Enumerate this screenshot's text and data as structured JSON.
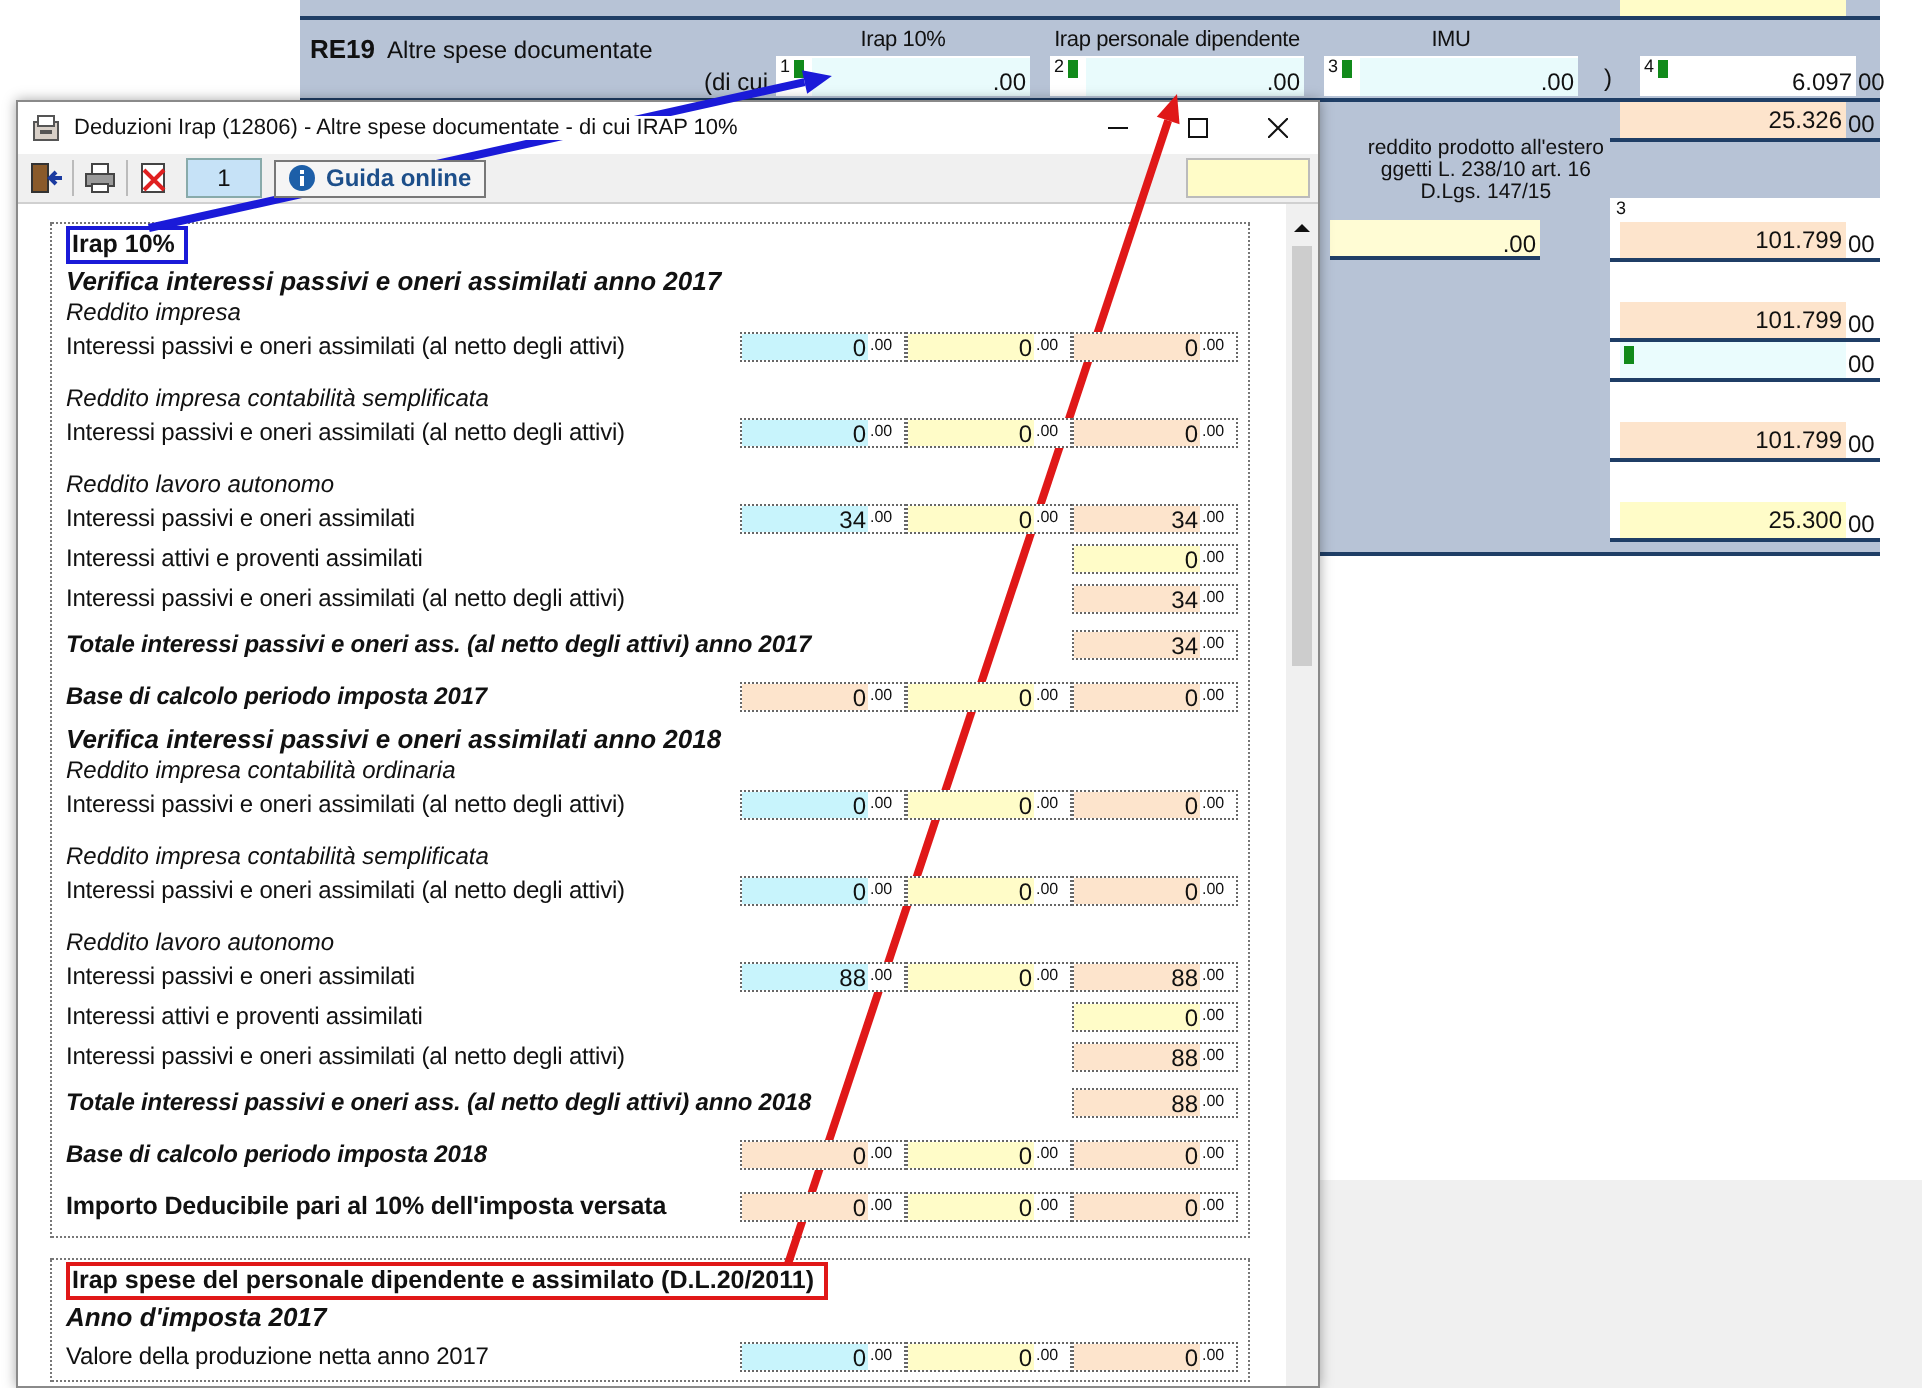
{
  "background_form": {
    "line_code": "RE19",
    "line_label": "Altre spese documentate",
    "of_which": "(di cui",
    "closing": ")",
    "fields": [
      {
        "header": "Irap 10%",
        "index": "1",
        "decimals": ".00",
        "marked": true
      },
      {
        "header": "Irap personale dipendente",
        "index": "2",
        "decimals": ".00",
        "marked": true
      },
      {
        "header": "IMU",
        "index": "3",
        "decimals": ".00",
        "marked": true
      },
      {
        "index": "4",
        "value": "6.097",
        "decimals": "00",
        "marked": true
      }
    ],
    "note": [
      "reddito prodotto all'estero",
      "ggetti L. 238/10 art. 16",
      "D.Lgs. 147/15"
    ],
    "note_field": {
      "decimals": ".00",
      "color": "#fffcd4"
    },
    "column_fields": [
      {
        "value": "25.326",
        "decimals": "00",
        "color": "#fde4cc",
        "marked": false
      },
      {
        "index": "3",
        "value": "101.799",
        "decimals": "00",
        "color": "#fde4cc",
        "marked": false
      },
      {
        "value": "101.799",
        "decimals": "00",
        "color": "#fde4cc",
        "marked": false
      },
      {
        "decimals": "00",
        "color": "#eafcfd",
        "marked": true
      },
      {
        "value": "101.799",
        "decimals": "00",
        "color": "#fde4cc",
        "marked": false
      },
      {
        "value": "25.300",
        "decimals": "00",
        "color": "#fffcc8",
        "marked": false
      }
    ]
  },
  "dialog": {
    "title": "Deduzioni Irap (12806) - Altre spese documentate - di cui IRAP 10%",
    "toolbar": {
      "counter": "1",
      "help_button": "Guida online"
    },
    "sections": [
      {
        "title": "Irap 10%",
        "color": "#1a1ad8",
        "rows": [
          {
            "kind": "heading",
            "text": "Verifica interessi passivi e oneri assimilati anno 2017"
          },
          {
            "kind": "subheading",
            "text": "Reddito impresa"
          },
          {
            "kind": "row",
            "label": "Interessi passivi e oneri assimilati (al netto degli attivi)",
            "fields": [
              {
                "value": "0",
                "decimals": ".00",
                "color": "#c8f4fc"
              },
              {
                "value": "0",
                "decimals": ".00",
                "color": "#fffcc8"
              },
              {
                "value": "0",
                "decimals": ".00",
                "color": "#fde4cc"
              }
            ]
          },
          {
            "kind": "subheading",
            "text": "Reddito impresa contabilità semplificata"
          },
          {
            "kind": "row",
            "label": "Interessi passivi e oneri assimilati (al netto degli attivi)",
            "fields": [
              {
                "value": "0",
                "decimals": ".00",
                "color": "#c8f4fc"
              },
              {
                "value": "0",
                "decimals": ".00",
                "color": "#fffcc8"
              },
              {
                "value": "0",
                "decimals": ".00",
                "color": "#fde4cc"
              }
            ]
          },
          {
            "kind": "subheading",
            "text": "Reddito lavoro autonomo"
          },
          {
            "kind": "row",
            "label": "Interessi passivi e oneri assimilati",
            "fields": [
              {
                "value": "34",
                "decimals": ".00",
                "color": "#c8f4fc"
              },
              {
                "value": "0",
                "decimals": ".00",
                "color": "#fffcc8"
              },
              {
                "value": "34",
                "decimals": ".00",
                "color": "#fde4cc"
              }
            ]
          },
          {
            "kind": "row",
            "label": "Interessi attivi e proventi assimilati",
            "fields": [
              {
                "value": "0",
                "decimals": ".00",
                "color": "#fffcc8"
              }
            ]
          },
          {
            "kind": "row",
            "label": "Interessi passivi e oneri assimilati (al netto degli attivi)",
            "fields": [
              {
                "value": "34",
                "decimals": ".00",
                "color": "#fde4cc"
              }
            ]
          },
          {
            "kind": "total",
            "label": "Totale interessi passivi e oneri ass. (al netto degli attivi) anno 2017",
            "fields": [
              {
                "value": "34",
                "decimals": ".00",
                "color": "#fde4cc"
              }
            ]
          },
          {
            "kind": "total",
            "label": "Base di calcolo periodo imposta 2017",
            "fields": [
              {
                "value": "0",
                "decimals": ".00",
                "color": "#fde4cc"
              },
              {
                "value": "0",
                "decimals": ".00",
                "color": "#fffcc8"
              },
              {
                "value": "0",
                "decimals": ".00",
                "color": "#fde4cc"
              }
            ]
          },
          {
            "kind": "heading",
            "text": "Verifica interessi passivi e oneri assimilati anno 2018"
          },
          {
            "kind": "subheading",
            "text": "Reddito impresa contabilità ordinaria"
          },
          {
            "kind": "row",
            "label": "Interessi passivi e oneri assimilati (al netto degli attivi)",
            "fields": [
              {
                "value": "0",
                "decimals": ".00",
                "color": "#c8f4fc"
              },
              {
                "value": "0",
                "decimals": ".00",
                "color": "#fffcc8"
              },
              {
                "value": "0",
                "decimals": ".00",
                "color": "#fde4cc"
              }
            ]
          },
          {
            "kind": "subheading",
            "text": "Reddito impresa contabilità semplificata"
          },
          {
            "kind": "row",
            "label": "Interessi passivi e oneri assimilati (al netto degli attivi)",
            "fields": [
              {
                "value": "0",
                "decimals": ".00",
                "color": "#c8f4fc"
              },
              {
                "value": "0",
                "decimals": ".00",
                "color": "#fffcc8"
              },
              {
                "value": "0",
                "decimals": ".00",
                "color": "#fde4cc"
              }
            ]
          },
          {
            "kind": "subheading",
            "text": "Reddito lavoro autonomo"
          },
          {
            "kind": "row",
            "label": "Interessi passivi e oneri assimilati",
            "fields": [
              {
                "value": "88",
                "decimals": ".00",
                "color": "#c8f4fc"
              },
              {
                "value": "0",
                "decimals": ".00",
                "color": "#fffcc8"
              },
              {
                "value": "88",
                "decimals": ".00",
                "color": "#fde4cc"
              }
            ]
          },
          {
            "kind": "row",
            "label": "Interessi attivi e proventi assimilati",
            "fields": [
              {
                "value": "0",
                "decimals": ".00",
                "color": "#fffcc8"
              }
            ]
          },
          {
            "kind": "row",
            "label": "Interessi passivi e oneri assimilati (al netto degli attivi)",
            "fields": [
              {
                "value": "88",
                "decimals": ".00",
                "color": "#fde4cc"
              }
            ]
          },
          {
            "kind": "total",
            "label": "Totale interessi passivi e oneri ass. (al netto degli attivi) anno 2018",
            "fields": [
              {
                "value": "88",
                "decimals": ".00",
                "color": "#fde4cc"
              }
            ]
          },
          {
            "kind": "total",
            "label": "Base di calcolo periodo imposta 2018",
            "fields": [
              {
                "value": "0",
                "decimals": ".00",
                "color": "#fde4cc"
              },
              {
                "value": "0",
                "decimals": ".00",
                "color": "#fffcc8"
              },
              {
                "value": "0",
                "decimals": ".00",
                "color": "#fde4cc"
              }
            ]
          },
          {
            "kind": "result",
            "label": "Importo Deducibile pari al 10% dell'imposta versata",
            "fields": [
              {
                "value": "0",
                "decimals": ".00",
                "color": "#fde4cc"
              },
              {
                "value": "0",
                "decimals": ".00",
                "color": "#fffcc8"
              },
              {
                "value": "0",
                "decimals": ".00",
                "color": "#fde4cc"
              }
            ]
          }
        ]
      },
      {
        "title": "Irap spese del personale dipendente e assimilato (D.L.20/2011)",
        "color": "#e01818",
        "rows": [
          {
            "kind": "heading",
            "text": "Anno d'imposta 2017"
          },
          {
            "kind": "row",
            "label": "Valore della produzione netta anno 2017",
            "fields": [
              {
                "value": "0",
                "decimals": ".00",
                "color": "#c8f4fc"
              },
              {
                "value": "0",
                "decimals": ".00",
                "color": "#fffcc8"
              },
              {
                "value": "0",
                "decimals": ".00",
                "color": "#fde4cc"
              }
            ]
          }
        ]
      }
    ]
  }
}
